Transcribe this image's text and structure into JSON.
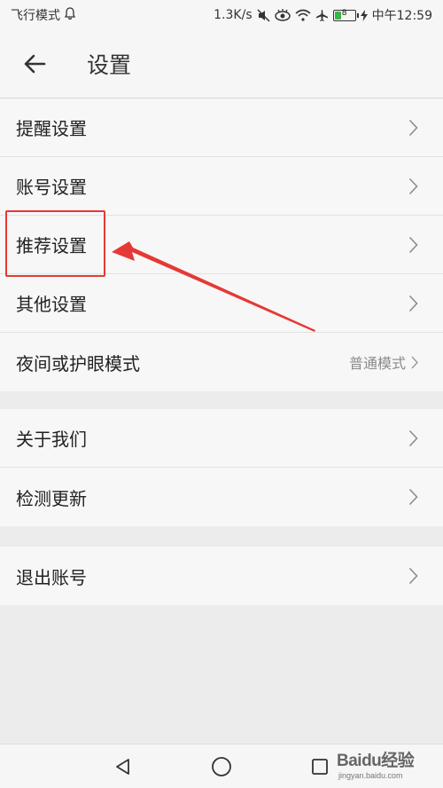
{
  "status_bar": {
    "mode": "飞行模式",
    "speed": "1.3K/s",
    "battery_level": "8",
    "time": "中午12:59"
  },
  "header": {
    "title": "设置"
  },
  "groups": [
    {
      "items": [
        {
          "label": "提醒设置"
        },
        {
          "label": "账号设置"
        },
        {
          "label": "推荐设置"
        },
        {
          "label": "其他设置"
        },
        {
          "label": "夜间或护眼模式",
          "value": "普通模式"
        }
      ]
    },
    {
      "items": [
        {
          "label": "关于我们"
        },
        {
          "label": "检测更新"
        }
      ]
    },
    {
      "items": [
        {
          "label": "退出账号"
        }
      ]
    }
  ],
  "watermark": {
    "main": "Baidu经验",
    "sub": "jingyan.baidu.com"
  },
  "colors": {
    "annotation": "#e53935",
    "background": "#ececec",
    "row_bg": "#f7f7f7",
    "chevron": "#8c8c8c"
  }
}
